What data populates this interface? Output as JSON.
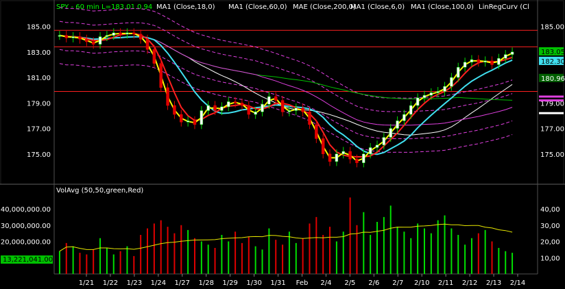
{
  "header": {
    "symbol_label": "SPY - 60 min",
    "last_label": "L=183.01",
    "change_label": "0.94",
    "indicators": [
      "MA1 (Close,18,0)",
      "MA1 (Close,60,0)",
      "MAE (Close,200,0)",
      "MA1 (Close,6,0)",
      "MA1 (Close,100,0)",
      "LinRegCurv (Cl"
    ]
  },
  "volume_panel": {
    "label": "VolAvg (50,50,green,Red)",
    "current_volume_label": "13,221,041.00"
  },
  "colors": {
    "background": "#000000",
    "up": "#00e000",
    "down": "#e00000",
    "ma6": "#ffff00",
    "ma18": "#ff2020",
    "ma60": "#40e0f0",
    "ma100": "#e040e0",
    "ma200": "#00c000",
    "mae_band": "#e040e0",
    "linreg": "#ffffff",
    "hline": "#ff2020",
    "vol_avg": "#e8e800",
    "text": "#ffffff",
    "header_text": "#00ff00"
  },
  "chart_data": [
    {
      "type": "candlestick",
      "name": "price",
      "x": [
        "1/21",
        "1/22",
        "1/23",
        "1/24",
        "1/27",
        "1/28",
        "1/29",
        "1/30",
        "1/31",
        "Feb",
        "2/4",
        "2/5",
        "2/6",
        "2/7",
        "2/10",
        "2/11",
        "2/12",
        "2/13",
        "2/14"
      ],
      "ylim": [
        173,
        186
      ],
      "y_ticks": [
        175,
        177,
        179,
        181,
        183,
        185
      ],
      "y_tick_labels": [
        "175.00",
        "177.00",
        "179.00",
        "181.00",
        "183.00",
        "185.00"
      ],
      "right_tick_labels": [
        "175.00",
        "177.00",
        "179.00",
        "181.00",
        "183.00",
        "185.00"
      ],
      "grid": false,
      "horizontal_lines": [
        184.7,
        183.4,
        179.9
      ],
      "value_markers": [
        {
          "label": "183.05",
          "value": 183.05,
          "color": "#00c000",
          "text_color": "#000000"
        },
        {
          "label": "182.30",
          "value": 182.3,
          "color": "#40e0f0",
          "text_color": "#000000"
        },
        {
          "label": "180.96",
          "value": 180.96,
          "color": "#006000",
          "text_color": "#ffffff"
        }
      ],
      "closes": [
        184.3,
        184.1,
        184.2,
        184.0,
        183.8,
        183.6,
        184.2,
        184.3,
        184.5,
        184.4,
        184.5,
        184.4,
        184.0,
        183.2,
        182.1,
        180.2,
        178.8,
        178.1,
        177.5,
        177.6,
        177.3,
        178.4,
        178.8,
        178.4,
        178.7,
        179.1,
        179.0,
        178.8,
        178.1,
        178.3,
        178.9,
        179.5,
        179.2,
        178.3,
        178.4,
        178.6,
        178.3,
        177.3,
        176.2,
        175.0,
        174.4,
        175.0,
        175.2,
        174.6,
        174.3,
        175.0,
        175.5,
        175.7,
        176.3,
        177.0,
        177.6,
        178.1,
        178.8,
        179.4,
        179.6,
        179.8,
        179.9,
        180.3,
        181.0,
        181.8,
        182.2,
        182.4,
        182.2,
        182.3,
        182.0,
        182.5,
        182.8,
        183.0
      ],
      "volumes_millions": [
        14,
        19,
        17,
        13,
        12,
        15,
        22,
        16,
        12,
        14,
        17,
        11,
        24,
        28,
        31,
        33,
        29,
        25,
        30,
        27,
        22,
        20,
        18,
        16,
        24,
        20,
        26,
        19,
        23,
        17,
        15,
        28,
        21,
        18,
        26,
        19,
        22,
        31,
        35,
        24,
        29,
        20,
        26,
        47,
        30,
        38,
        24,
        32,
        35,
        42,
        29,
        26,
        22,
        31,
        28,
        25,
        33,
        36,
        28,
        24,
        18,
        22,
        25,
        27,
        20,
        16,
        14,
        13
      ],
      "series": [
        {
          "name": "MA1 (Close,6,0)",
          "color": "#ffff00",
          "width": 2
        },
        {
          "name": "MA1 (Close,18,0)",
          "color": "#ff2020",
          "width": 2
        },
        {
          "name": "MA1 (Close,60,0)",
          "color": "#40e0f0",
          "width": 2
        },
        {
          "name": "MA1 (Close,100,0)",
          "color": "#e040e0",
          "width": 1
        },
        {
          "name": "MA1 (Close,200,0)",
          "color": "#00c000",
          "width": 1
        },
        {
          "name": "LinRegCurv",
          "color": "#ffffff",
          "width": 1
        }
      ]
    },
    {
      "type": "bar",
      "name": "volume",
      "ylim": [
        0,
        48
      ],
      "y_ticks": [
        10,
        20,
        30,
        40
      ],
      "y_tick_labels": [
        "10,000,000.00",
        "20,000,000.00",
        "30,000,000.00",
        "40,000,000.00"
      ],
      "right_tick_labels": [
        "10,00",
        "20,00",
        "30,00",
        "40,00"
      ],
      "average_line": "VolAvg (50,50,green,Red)"
    }
  ]
}
